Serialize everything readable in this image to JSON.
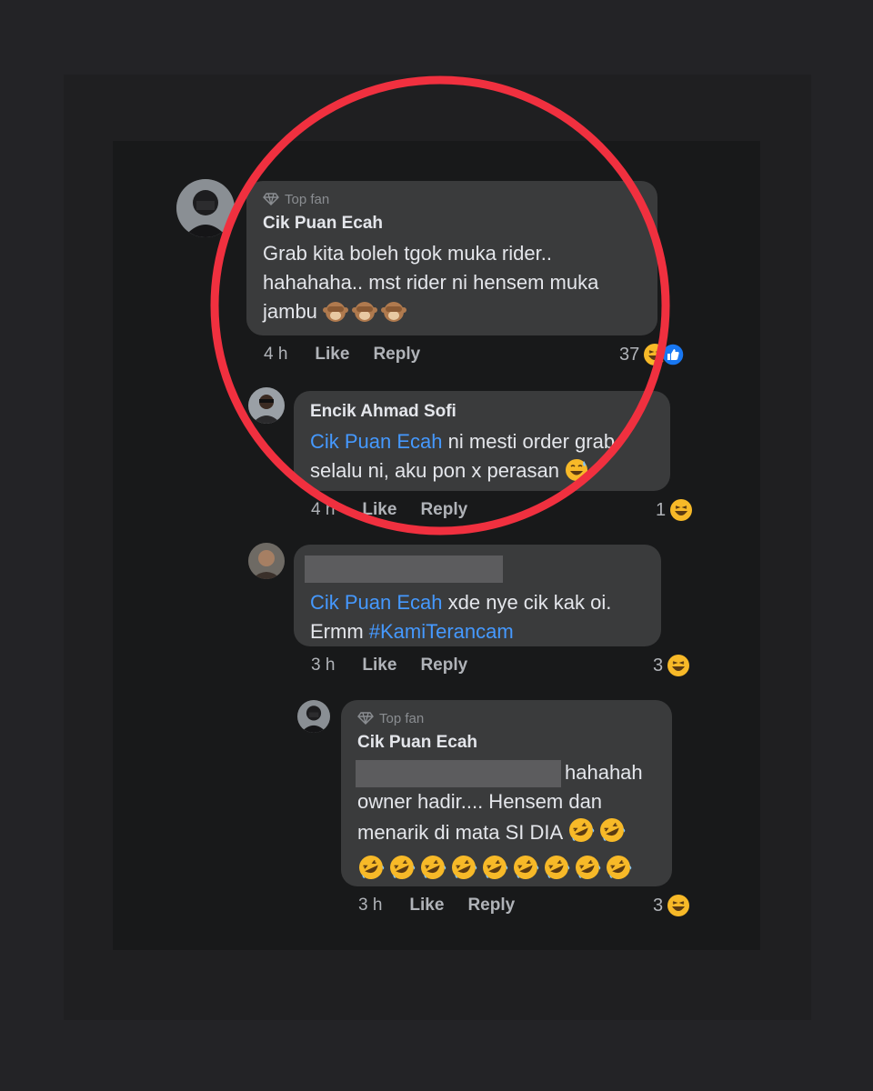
{
  "comments": [
    {
      "badge": "Top fan",
      "author": "Cik Puan Ecah",
      "text_line1": "Grab kita boleh tgok muka rider..",
      "text_line2": "hahahaha.. mst rider ni hensem muka",
      "text_line3": "jambu",
      "emoji": [
        "monkey-cover-eyes",
        "monkey-cover-eyes",
        "monkey-cover-eyes"
      ],
      "time": "4 h",
      "like": "Like",
      "reply": "Reply",
      "reaction_count": "37",
      "reactions": [
        "haha",
        "like"
      ]
    },
    {
      "author": "Encik Ahmad Sofi",
      "mention": "Cik Puan Ecah",
      "text_line1": " ni mesti order grab",
      "text_line2": "selalu ni, aku pon x perasan",
      "time": "4 h",
      "like": "Like",
      "reply": "Reply",
      "reaction_count": "1",
      "reactions": [
        "haha"
      ]
    },
    {
      "mention": "Cik Puan Ecah",
      "text_line1": " xde nye cik kak oi.",
      "text_line2_prefix": "Ermm ",
      "hashtag": "#KamiTerancam",
      "time": "3 h",
      "like": "Like",
      "reply": "Reply",
      "reaction_count": "3",
      "reactions": [
        "haha"
      ]
    },
    {
      "badge": "Top fan",
      "author": "Cik Puan Ecah",
      "text_line1": "hahahah",
      "text_line2": "owner hadir.... Hensem dan",
      "text_line3": "menarik di mata SI DIA",
      "time": "3 h",
      "like": "Like",
      "reply": "Reply",
      "reaction_count": "3",
      "reactions": [
        "haha"
      ]
    }
  ],
  "colors": {
    "annotation_circle": "#f0303f",
    "mention": "#4599ff",
    "bubble": "#3a3b3c"
  }
}
